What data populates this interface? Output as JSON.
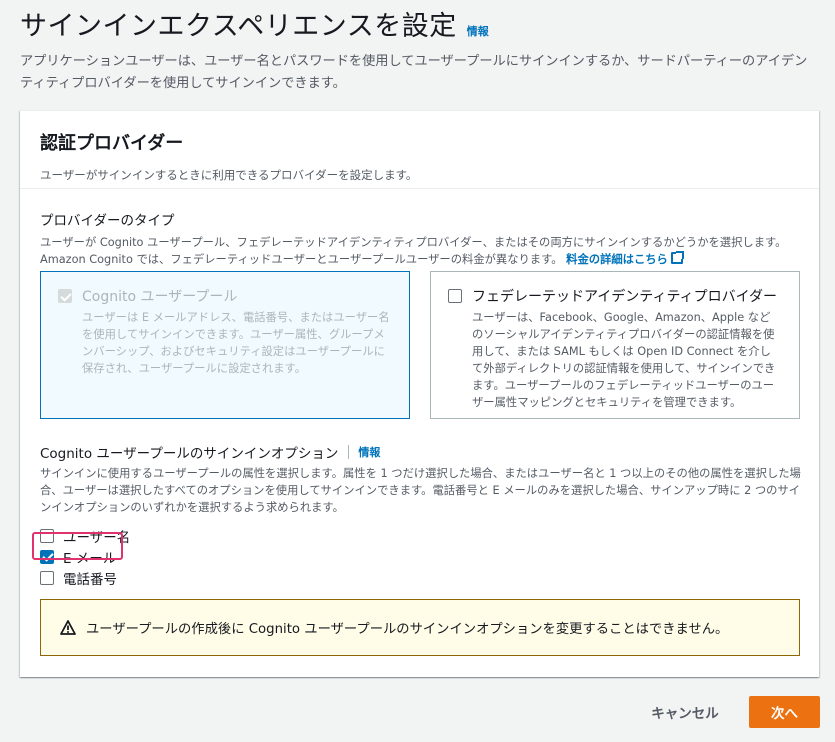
{
  "page": {
    "title": "サインインエクスペリエンスを設定",
    "info_link": "情報",
    "description": "アプリケーションユーザーは、ユーザー名とパスワードを使用してユーザープールにサインインするか、サードパーティーのアイデンティティプロバイダーを使用してサインインできます。"
  },
  "panel": {
    "title": "認証プロバイダー",
    "description": "ユーザーがサインインするときに利用できるプロバイダーを設定します。"
  },
  "provider_types": {
    "label": "プロバイダーのタイプ",
    "description": "ユーザーが Cognito ユーザープール、フェデレーテッドアイデンティティプロバイダー、またはその両方にサインインするかどうかを選択します。Amazon Cognito では、フェデレーティッドユーザーとユーザープールユーザーの料金が異なります。",
    "pricing_link": "料金の詳細はこちら",
    "options": [
      {
        "title": "Cognito ユーザープール",
        "description": "ユーザーは E メールアドレス、電話番号、またはユーザー名を使用してサインインできます。ユーザー属性、グループメンバーシップ、およびセキュリティ設定はユーザープールに保存され、ユーザープールに設定されます。",
        "checked": true,
        "disabled": true
      },
      {
        "title": "フェデレーテッドアイデンティティプロバイダー",
        "description": "ユーザーは、Facebook、Google、Amazon、Apple などのソーシャルアイデンティティプロバイダーの認証情報を使用して、または SAML もしくは Open ID Connect を介して外部ディレクトリの認証情報を使用して、サインインできます。ユーザープールのフェデレーティッドユーザーのユーザー属性マッピングとセキュリティを管理できます。",
        "checked": false,
        "disabled": false
      }
    ]
  },
  "signin_options": {
    "label": "Cognito ユーザープールのサインインオプション",
    "info_link": "情報",
    "description": "サインインに使用するユーザープールの属性を選択します。属性を 1 つだけ選択した場合、またはユーザー名と 1 つ以上のその他の属性を選択した場合、ユーザーは選択したすべてのオプションを使用してサインインできます。電話番号と E メールのみを選択した場合、サインアップ時に 2 つのサインインオプションのいずれかを選択するよう求められます。",
    "options": [
      {
        "label": "ユーザー名",
        "checked": false
      },
      {
        "label": "E メール",
        "checked": true
      },
      {
        "label": "電話番号",
        "checked": false
      }
    ]
  },
  "alert": {
    "icon": "warning-icon",
    "text": "ユーザープールの作成後に Cognito ユーザープールのサインインオプションを変更することはできません。"
  },
  "footer": {
    "cancel_label": "キャンセル",
    "next_label": "次へ"
  },
  "colors": {
    "accent": "#0073bb",
    "primary_button": "#ec7211",
    "highlight": "#e0336e",
    "warning_border": "#8d6605"
  }
}
